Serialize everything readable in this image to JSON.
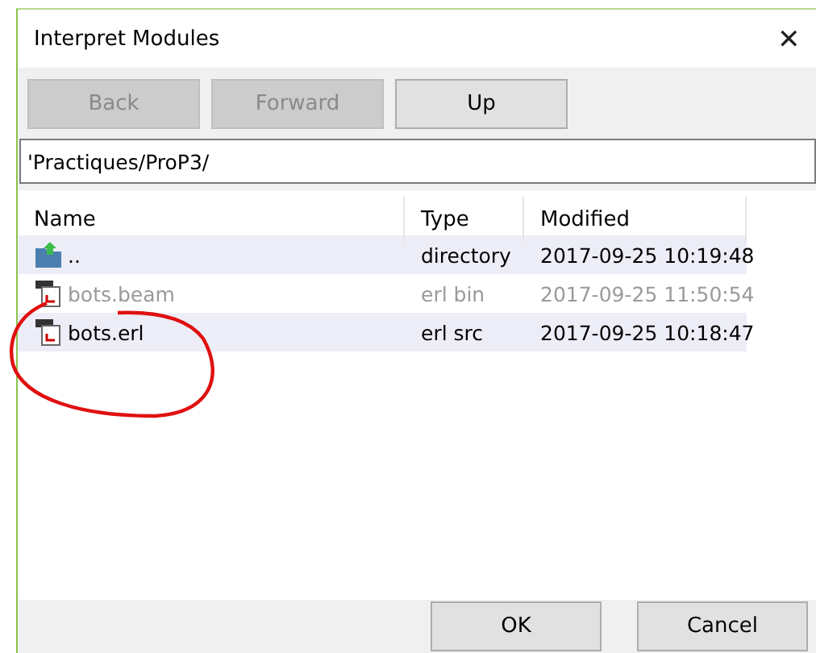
{
  "window": {
    "title": "Interpret Modules",
    "close": "✕"
  },
  "toolbar": [
    {
      "label": "Back",
      "disabled": true
    },
    {
      "label": "Forward",
      "disabled": true
    },
    {
      "label": "Up",
      "disabled": false
    }
  ],
  "path": "'Practiques/ProP3/",
  "table": {
    "columns": [
      "Name",
      "Type",
      "Modified"
    ],
    "rows": [
      {
        "kind": "up",
        "name": "..",
        "type": "directory",
        "modified": "2017-09-25 10:19:48",
        "disabled": false
      },
      {
        "kind": "file",
        "name": "bots.beam",
        "type": "erl bin",
        "modified": "2017-09-25 11:50:54",
        "disabled": true
      },
      {
        "kind": "file",
        "name": "bots.erl",
        "type": "erl src",
        "modified": "2017-09-25 10:18:47",
        "disabled": false
      }
    ]
  },
  "buttons": [
    "OK",
    "Cancel"
  ]
}
